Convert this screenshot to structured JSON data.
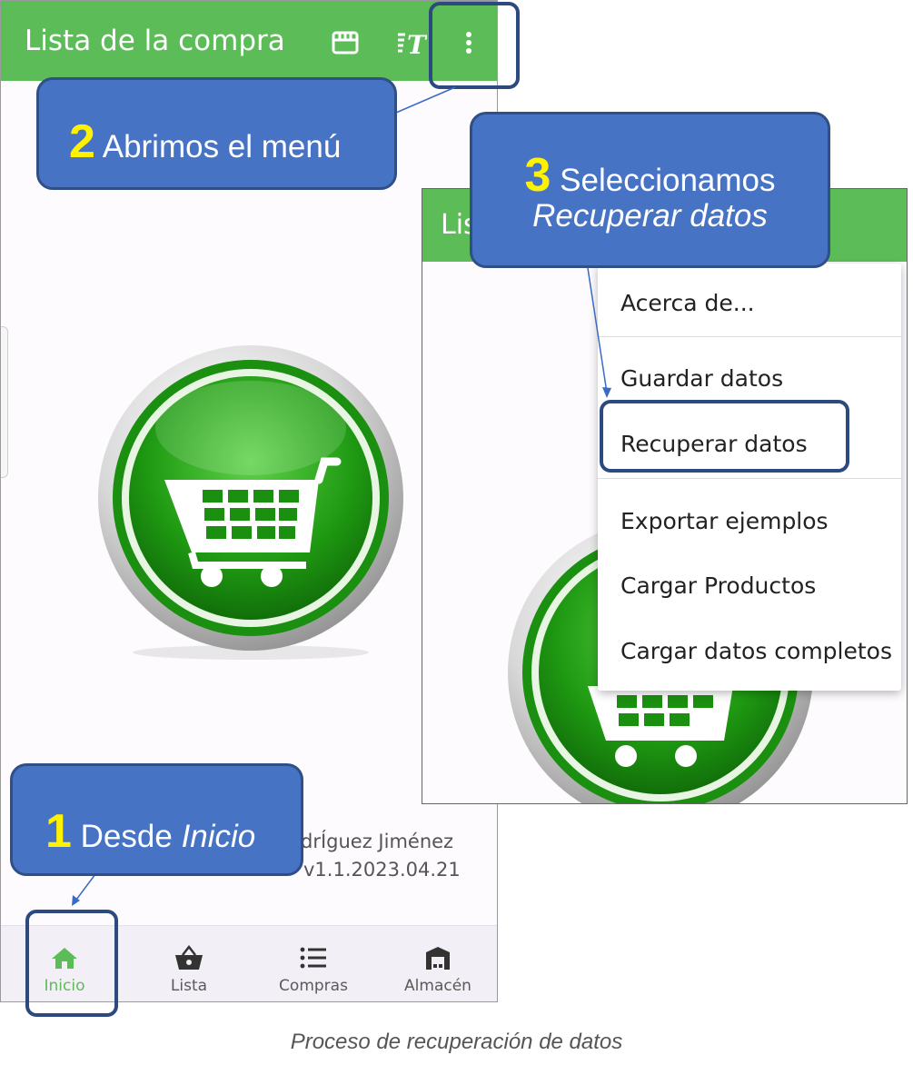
{
  "app": {
    "title": "Lista de la compra",
    "title_partial": "Lis",
    "author": "drÍguez Jiménez",
    "version": "v1.1.2023.04.21"
  },
  "appbar_icons": [
    "store-icon",
    "text-format-icon",
    "more-vert-icon"
  ],
  "bottom_nav": [
    {
      "label": "Inicio",
      "icon": "home-icon",
      "active": true
    },
    {
      "label": "Lista",
      "icon": "basket-icon",
      "active": false
    },
    {
      "label": "Compras",
      "icon": "list-icon",
      "active": false
    },
    {
      "label": "Almacén",
      "icon": "warehouse-icon",
      "active": false
    }
  ],
  "menu": {
    "items": [
      "Acerca de...",
      "Guardar datos",
      "Recuperar datos",
      "Exportar ejemplos",
      "Cargar Productos",
      "Cargar datos completos"
    ]
  },
  "callouts": {
    "step1": {
      "num": "1",
      "text": "Desde ",
      "italic": "Inicio"
    },
    "step2": {
      "num": "2",
      "text": "Abrimos el menú"
    },
    "step3": {
      "num": "3",
      "text": "Seleccionamos",
      "italic": "Recuperar datos"
    }
  },
  "caption": "Proceso de recuperación de datos",
  "colors": {
    "appbar": "#5cbd58",
    "callout": "#4773c5",
    "callout_border": "#2f4f86",
    "number": "#fff200",
    "nav_bg": "#f3eff6"
  }
}
